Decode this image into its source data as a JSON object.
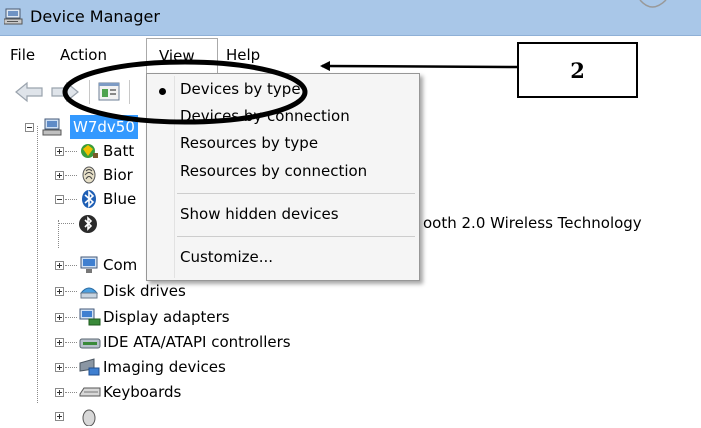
{
  "window": {
    "title": "Device Manager"
  },
  "menu": {
    "file": "File",
    "action": "Action",
    "view": "View",
    "help": "Help"
  },
  "view_menu": {
    "items": [
      {
        "label": "Devices by type",
        "checked": true
      },
      {
        "label": "Devices by connection"
      },
      {
        "label": "Resources by type"
      },
      {
        "label": "Resources by connection"
      },
      {
        "label": "Show hidden devices"
      },
      {
        "label": "Customize..."
      }
    ]
  },
  "tree": {
    "root": "W7dv50",
    "nodes": [
      {
        "label": "Batt",
        "icon": "battery-icon"
      },
      {
        "label": "Bior",
        "icon": "fingerprint-icon"
      },
      {
        "label": "Blue",
        "icon": "bluetooth-icon",
        "expanded": true
      },
      {
        "label": "ooth 2.0 Wireless Technology",
        "icon": "bluetooth-device-icon"
      },
      {
        "label": "Com",
        "icon": "computer-icon"
      },
      {
        "label": "Disk drives",
        "icon": "disk-drive-icon"
      },
      {
        "label": "Display adapters",
        "icon": "display-adapter-icon"
      },
      {
        "label": "IDE ATA/ATAPI controllers",
        "icon": "ide-controller-icon"
      },
      {
        "label": "Imaging devices",
        "icon": "camera-icon"
      },
      {
        "label": "Keyboards",
        "icon": "keyboard-icon"
      }
    ]
  },
  "annotation": {
    "callout_number": "2"
  },
  "colors": {
    "titlebar": "#a9c7e8",
    "selection": "#3399ff",
    "menu_bg": "#f5f5f5"
  }
}
